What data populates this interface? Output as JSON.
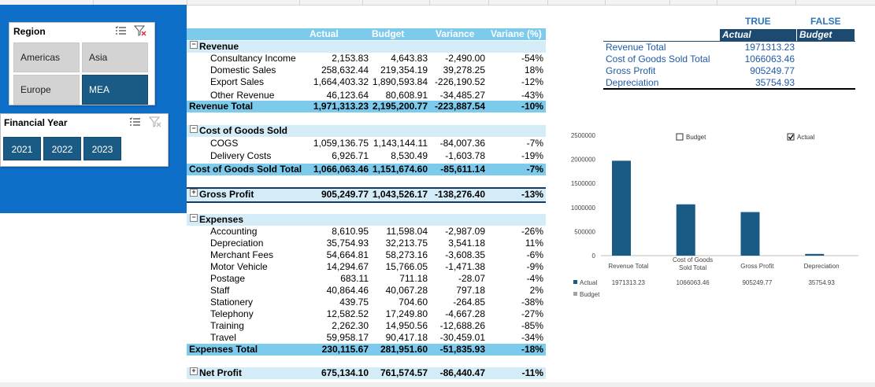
{
  "slicers": {
    "region": {
      "title": "Region",
      "items": [
        {
          "label": "Americas",
          "selected": false
        },
        {
          "label": "Asia",
          "selected": false
        },
        {
          "label": "Europe",
          "selected": false
        },
        {
          "label": "MEA",
          "selected": true
        }
      ]
    },
    "year": {
      "title": "Financial Year",
      "items": [
        {
          "label": "2021",
          "selected": true
        },
        {
          "label": "2022",
          "selected": true
        },
        {
          "label": "2023",
          "selected": true
        }
      ]
    }
  },
  "pivot": {
    "headers": {
      "actual": "Actual",
      "budget": "Budget",
      "variance": "Variance",
      "variance_pct": "Variane (%)"
    },
    "revenue": {
      "label": "Revenue",
      "rows": [
        {
          "name": "Consultancy Income",
          "actual": "2,153.83",
          "budget": "4,643.83",
          "variance": "-2,490.00",
          "pct": "-54%"
        },
        {
          "name": "Domestic Sales",
          "actual": "258,632.44",
          "budget": "219,354.19",
          "variance": "39,278.25",
          "pct": "18%"
        },
        {
          "name": "Export Sales",
          "actual": "1,664,403.32",
          "budget": "1,890,593.84",
          "variance": "-226,190.52",
          "pct": "-12%"
        },
        {
          "name": "Other Revenue",
          "actual": "46,123.64",
          "budget": "80,608.91",
          "variance": "-34,485.27",
          "pct": "-43%"
        }
      ],
      "total": {
        "name": "Revenue Total",
        "actual": "1,971,313.23",
        "budget": "2,195,200.77",
        "variance": "-223,887.54",
        "pct": "-10%"
      }
    },
    "cogs": {
      "label": "Cost of Goods Sold",
      "rows": [
        {
          "name": "COGS",
          "actual": "1,059,136.75",
          "budget": "1,143,144.11",
          "variance": "-84,007.36",
          "pct": "-7%"
        },
        {
          "name": "Delivery Costs",
          "actual": "6,926.71",
          "budget": "8,530.49",
          "variance": "-1,603.78",
          "pct": "-19%"
        }
      ],
      "total": {
        "name": "Cost of Goods Sold Total",
        "actual": "1,066,063.46",
        "budget": "1,151,674.60",
        "variance": "-85,611.14",
        "pct": "-7%"
      }
    },
    "gross_profit": {
      "name": "Gross Profit",
      "actual": "905,249.77",
      "budget": "1,043,526.17",
      "variance": "-138,276.40",
      "pct": "-13%"
    },
    "expenses": {
      "label": "Expenses",
      "rows": [
        {
          "name": "Accounting",
          "actual": "8,610.95",
          "budget": "11,598.04",
          "variance": "-2,987.09",
          "pct": "-26%"
        },
        {
          "name": "Depreciation",
          "actual": "35,754.93",
          "budget": "32,213.75",
          "variance": "3,541.18",
          "pct": "11%"
        },
        {
          "name": "Merchant Fees",
          "actual": "54,664.81",
          "budget": "58,273.16",
          "variance": "-3,608.35",
          "pct": "-6%"
        },
        {
          "name": "Motor Vehicle",
          "actual": "14,294.67",
          "budget": "15,766.05",
          "variance": "-1,471.38",
          "pct": "-9%"
        },
        {
          "name": "Postage",
          "actual": "683.11",
          "budget": "711.18",
          "variance": "-28.07",
          "pct": "-4%"
        },
        {
          "name": "Staff",
          "actual": "40,864.46",
          "budget": "40,067.28",
          "variance": "797.18",
          "pct": "2%"
        },
        {
          "name": "Stationery",
          "actual": "439.75",
          "budget": "704.60",
          "variance": "-264.85",
          "pct": "-38%"
        },
        {
          "name": "Telephony",
          "actual": "12,582.52",
          "budget": "17,249.80",
          "variance": "-4,667.28",
          "pct": "-27%"
        },
        {
          "name": "Training",
          "actual": "2,262.30",
          "budget": "14,950.56",
          "variance": "-12,688.26",
          "pct": "-85%"
        },
        {
          "name": "Travel",
          "actual": "59,958.17",
          "budget": "90,417.18",
          "variance": "-30,459.01",
          "pct": "-34%"
        }
      ],
      "total": {
        "name": "Expenses Total",
        "actual": "230,115.67",
        "budget": "281,951.60",
        "variance": "-51,835.93",
        "pct": "-18%"
      }
    },
    "net_profit": {
      "name": "Net Profit",
      "actual": "675,134.10",
      "budget": "761,574.57",
      "variance": "-86,440.47",
      "pct": "-11%"
    }
  },
  "summary": {
    "true_label": "TRUE",
    "false_label": "FALSE",
    "actual_header": "Actual",
    "budget_header": "Budget",
    "rows": [
      {
        "name": "Revenue Total",
        "actual": "1971313.23"
      },
      {
        "name": "Cost of Goods Sold Total",
        "actual": "1066063.46"
      },
      {
        "name": "Gross Profit",
        "actual": "905249.77"
      },
      {
        "name": "Depreciation",
        "actual": "35754.93"
      }
    ]
  },
  "chart_data": {
    "type": "bar",
    "categories": [
      "Revenue Total",
      "Cost of Goods Sold Total",
      "Gross Profit",
      "Depreciation"
    ],
    "series": [
      {
        "name": "Actual",
        "values": [
          1971313.23,
          1066063.46,
          905249.77,
          35754.93
        ]
      },
      {
        "name": "Budget",
        "values": [
          null,
          null,
          null,
          null
        ]
      }
    ],
    "table_values": [
      "1971313.23",
      "1066063.46",
      "905249.77",
      "35754.93"
    ],
    "ylim": [
      0,
      2500000
    ],
    "yticks": [
      "2500000",
      "2000000",
      "1500000",
      "1000000",
      "500000",
      "0"
    ],
    "legend_checkboxes": [
      {
        "label": "Budget",
        "checked": false
      },
      {
        "label": "Actual",
        "checked": true
      }
    ],
    "colors": {
      "actual": "#1a5b86",
      "budget": "#9aa4ab"
    }
  }
}
